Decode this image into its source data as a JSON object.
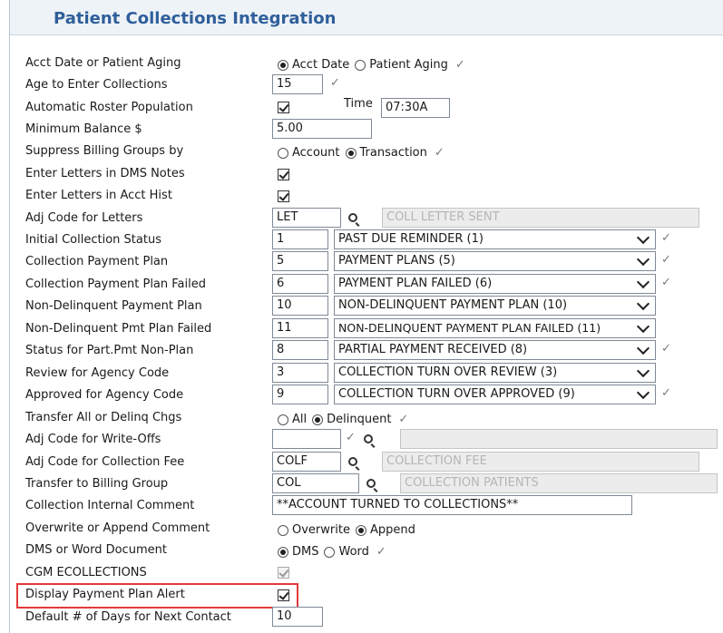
{
  "title": "Patient Collections Integration",
  "rows": [
    {
      "label": "Acct Date or Patient Aging",
      "radio1": "Acct Date",
      "radio2": "Patient Aging"
    },
    {
      "label": "Age to Enter Collections",
      "value": "15"
    },
    {
      "label": "Automatic Roster Population",
      "time_label": "Time",
      "time_value": "07:30A"
    },
    {
      "label": "Minimum Balance $",
      "value": "5.00"
    },
    {
      "label": "Suppress Billing Groups by",
      "radio1": "Account",
      "radio2": "Transaction"
    },
    {
      "label": "Enter Letters in DMS Notes"
    },
    {
      "label": "Enter Letters in Acct Hist"
    },
    {
      "label": "Adj Code for Letters",
      "code": "LET",
      "desc": "COLL LETTER SENT"
    },
    {
      "label": "Initial Collection Status",
      "code": "1",
      "desc": "PAST DUE REMINDER (1)"
    },
    {
      "label": "Collection Payment Plan",
      "code": "5",
      "desc": "PAYMENT PLANS (5)"
    },
    {
      "label": "Collection Payment Plan Failed",
      "code": "6",
      "desc": "PAYMENT PLAN FAILED (6)"
    },
    {
      "label": "Non-Delinquent Payment Plan",
      "code": "10",
      "desc": "NON-DELINQUENT PAYMENT PLAN (10)"
    },
    {
      "label": "Non-Delinquent Pmt Plan Failed",
      "code": "11",
      "desc": "NON-DELINQUENT PAYMENT PLAN FAILED (11)"
    },
    {
      "label": "Status for Part.Pmt Non-Plan",
      "code": "8",
      "desc": "PARTIAL PAYMENT RECEIVED (8)"
    },
    {
      "label": "Review for Agency Code",
      "code": "3",
      "desc": "COLLECTION TURN OVER REVIEW (3)"
    },
    {
      "label": "Approved for Agency Code",
      "code": "9",
      "desc": "COLLECTION TURN OVER APPROVED (9)"
    },
    {
      "label": "Transfer All or Delinq Chgs",
      "radio1": "All",
      "radio2": "Delinquent"
    },
    {
      "label": "Adj Code for Write-Offs",
      "code": "",
      "desc": ""
    },
    {
      "label": "Adj Code for Collection Fee",
      "code": "COLF",
      "desc": "COLLECTION FEE"
    },
    {
      "label": "Transfer to Billing Group",
      "code": "COL",
      "desc": "COLLECTION PATIENTS"
    },
    {
      "label": "Collection Internal Comment",
      "value": "**ACCOUNT TURNED TO COLLECTIONS**"
    },
    {
      "label": "Overwrite or Append Comment",
      "radio1": "Overwrite",
      "radio2": "Append"
    },
    {
      "label": "DMS or Word Document",
      "radio1": "DMS",
      "radio2": "Word"
    },
    {
      "label": "CGM ECOLLECTIONS"
    },
    {
      "label": "Display Payment Plan Alert"
    },
    {
      "label": "Default # of Days for Next Contact",
      "value": "10"
    }
  ],
  "colors": {
    "title": "#2f5f9a",
    "highlight": "#e23a3a"
  }
}
